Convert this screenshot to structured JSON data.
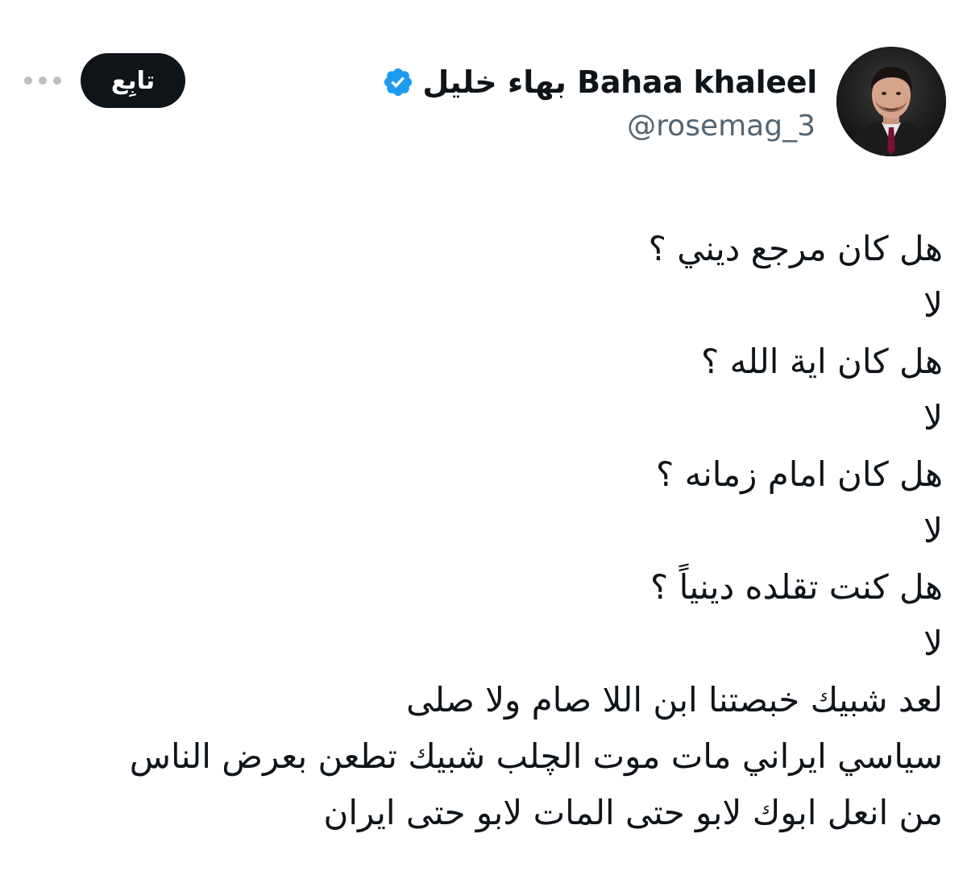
{
  "author": {
    "display_name": "بهاء خليل Bahaa khaleel",
    "handle": "@rosemag_3",
    "verified": true,
    "verified_color": "#1d9bf0",
    "avatar_icon": "profile-photo"
  },
  "actions": {
    "follow_label": "تابِع",
    "more_icon": "more-dots-icon"
  },
  "tweet": {
    "lines": [
      "هل كان مرجع ديني ؟",
      "لا",
      "هل كان اية الله ؟",
      "لا",
      "هل كان امام زمانه ؟",
      "لا",
      "هل كنت تقلده دينياً ؟",
      "لا",
      "لعد شبيك خبصتنا ابن اللا صام ولا صلى",
      "سياسي ايراني مات موت الچلب شبيك تطعن بعرض الناس",
      "من انعل ابوك لابو حتى المات لابو حتى ايران"
    ]
  }
}
